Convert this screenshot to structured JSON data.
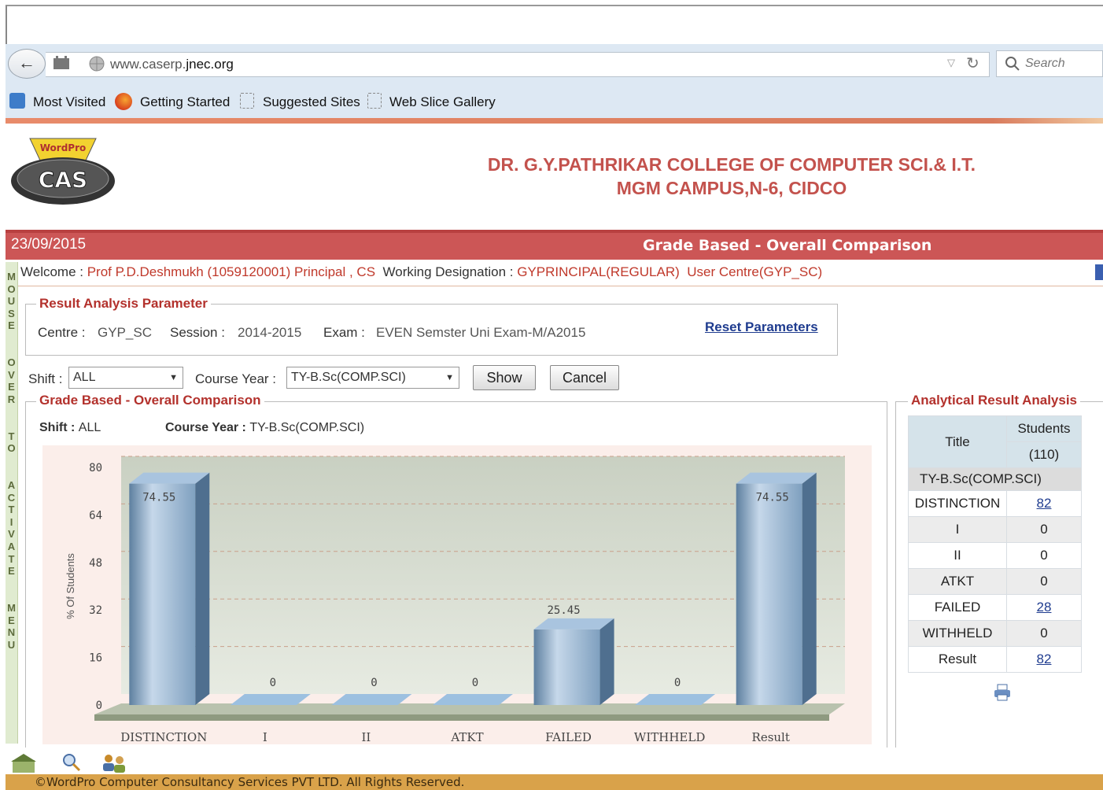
{
  "browser": {
    "url_prefix": "www.caserp.",
    "url_domain": "jnec.org",
    "search_placeholder": "Search",
    "bookmarks": [
      "Most Visited",
      "Getting Started",
      "Suggested Sites",
      "Web Slice Gallery"
    ]
  },
  "header": {
    "logo_text": "CAS",
    "logo_top": "WordPro",
    "college_line1": "DR. G.Y.PATHRIKAR COLLEGE OF COMPUTER SCI.& I.T.",
    "college_line2": "MGM CAMPUS,N-6, CIDCO",
    "date": "23/09/2015",
    "page_title": "Grade Based - Overall Comparison"
  },
  "welcome": {
    "label": "Welcome : ",
    "user": "Prof P.D.Deshmukh (1059120001) Principal , CS",
    "designation_label": "Working Designation : ",
    "designation": "GYPRINCIPAL(REGULAR)",
    "centre": "User Centre(GYP_SC)"
  },
  "sidebar_text": "MOUSE OVER TO ACTIVATE MENU",
  "params": {
    "legend": "Result Analysis Parameter",
    "centre_label": "Centre :",
    "centre": "GYP_SC",
    "session_label": "Session :",
    "session": "2014-2015",
    "exam_label": "Exam :",
    "exam": "EVEN Semster Uni Exam-M/A2015",
    "reset": "Reset Parameters"
  },
  "filters": {
    "shift_label": "Shift :",
    "shift": "ALL",
    "course_label": "Course Year :",
    "course": "TY-B.Sc(COMP.SCI)",
    "show": "Show",
    "cancel": "Cancel"
  },
  "chart_panel": {
    "legend": "Grade Based - Overall Comparison",
    "shift_label": "Shift : ",
    "shift": "ALL",
    "course_label": "Course Year : ",
    "course": "TY-B.Sc(COMP.SCI)"
  },
  "chart_data": {
    "type": "bar",
    "categories": [
      "DISTINCTION",
      "I",
      "II",
      "ATKT",
      "FAILED",
      "WITHHELD",
      "Result"
    ],
    "values": [
      74.55,
      0,
      0,
      0,
      25.45,
      0,
      74.55
    ],
    "ylabel": "% Of Students",
    "ylim": [
      0,
      80
    ],
    "yticks": [
      0,
      16,
      32,
      48,
      64,
      80
    ],
    "grid": true,
    "bar_color": "#8fb0cf"
  },
  "analytical": {
    "legend": "Analytical Result Analysis",
    "col_title": "Title",
    "col_students": "Students",
    "col_count": "(110)",
    "group": "TY-B.Sc(COMP.SCI)",
    "rows": [
      {
        "title": "DISTINCTION",
        "value": "82",
        "link": true
      },
      {
        "title": "I",
        "value": "0",
        "link": false
      },
      {
        "title": "II",
        "value": "0",
        "link": false
      },
      {
        "title": "ATKT",
        "value": "0",
        "link": false
      },
      {
        "title": "FAILED",
        "value": "28",
        "link": true
      },
      {
        "title": "WITHHELD",
        "value": "0",
        "link": false
      },
      {
        "title": "Result",
        "value": "82",
        "link": true
      }
    ]
  },
  "footer": {
    "copyright": "©WordPro Computer Consultancy Services PVT LTD. All Rights Reserved."
  },
  "colors": {
    "brand_red": "#cc5656",
    "title_red": "#c3524d",
    "footer": "#d9a24a"
  }
}
